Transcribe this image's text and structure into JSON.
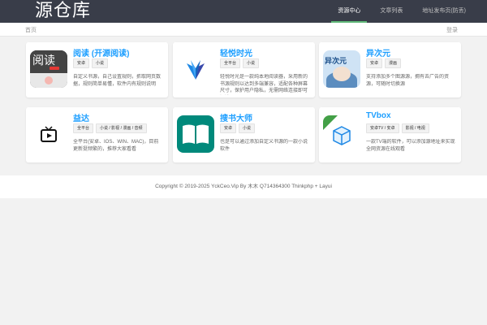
{
  "site": {
    "logo": "源仓库"
  },
  "nav": [
    {
      "label": "资源中心",
      "active": true
    },
    {
      "label": "文章列表",
      "active": false
    },
    {
      "label": "地址发布页(防丢)",
      "active": false
    }
  ],
  "breadcrumb": {
    "home": "首页",
    "login": "登录"
  },
  "cards": [
    {
      "title": "阅读 (开源阅读)",
      "tags": [
        "安卓",
        "小说"
      ],
      "desc": "自定义书源，自己设置规则，抓取网页数据，规则简单易懂，软件内有规则说明",
      "icon": "legado-read-app-icon",
      "icon_text": "阅读"
    },
    {
      "title": "轻悦时光",
      "tags": [
        "全平台",
        "小说"
      ],
      "desc": "轻悦时光是一款纯本地阅读器，采用新的书源规则以达到多端兼容，适配各种屏幕尺寸，保护用户隐私，无需网络连接即可阅读",
      "icon": "qingyue-bird-icon",
      "icon_text": ""
    },
    {
      "title": "异次元",
      "tags": [
        "安卓",
        "漫画"
      ],
      "desc": "支持添加多个图源源，拥有去广告的资源，可随时切换源",
      "icon": "yiciyuan-anime-icon",
      "icon_text": "异次元"
    },
    {
      "title": "益达",
      "tags": [
        "全平台",
        "小说 / 影视 / 漫画 / 音频"
      ],
      "desc": "全平台(安卓、IOS、WIN、MAC)，目前更新挺频繁的，推荐大家看看",
      "icon": "tv-play-icon",
      "icon_text": ""
    },
    {
      "title": "搜书大师",
      "tags": [
        "安卓",
        "小说"
      ],
      "desc": "也是可以通过添加自定义书源的一款小说软件",
      "icon": "open-book-icon",
      "icon_text": ""
    },
    {
      "title": "TVbox",
      "tags": [
        "安卓TV / 安卓",
        "影视 / 电视"
      ],
      "desc": "一款TV端的软件，可以添加源地址来实现全网资源在线观看",
      "icon": "tvbox-cube-icon",
      "icon_text": ""
    }
  ],
  "footer": {
    "text": "Copyright © 2019-2025 YckCeo.Vip    By 木木 Q714364300 Thinkphp + Layui"
  },
  "colors": {
    "topbar": "#393d49",
    "nav_active": "#5fb878",
    "card_title": "#1e9fff"
  }
}
